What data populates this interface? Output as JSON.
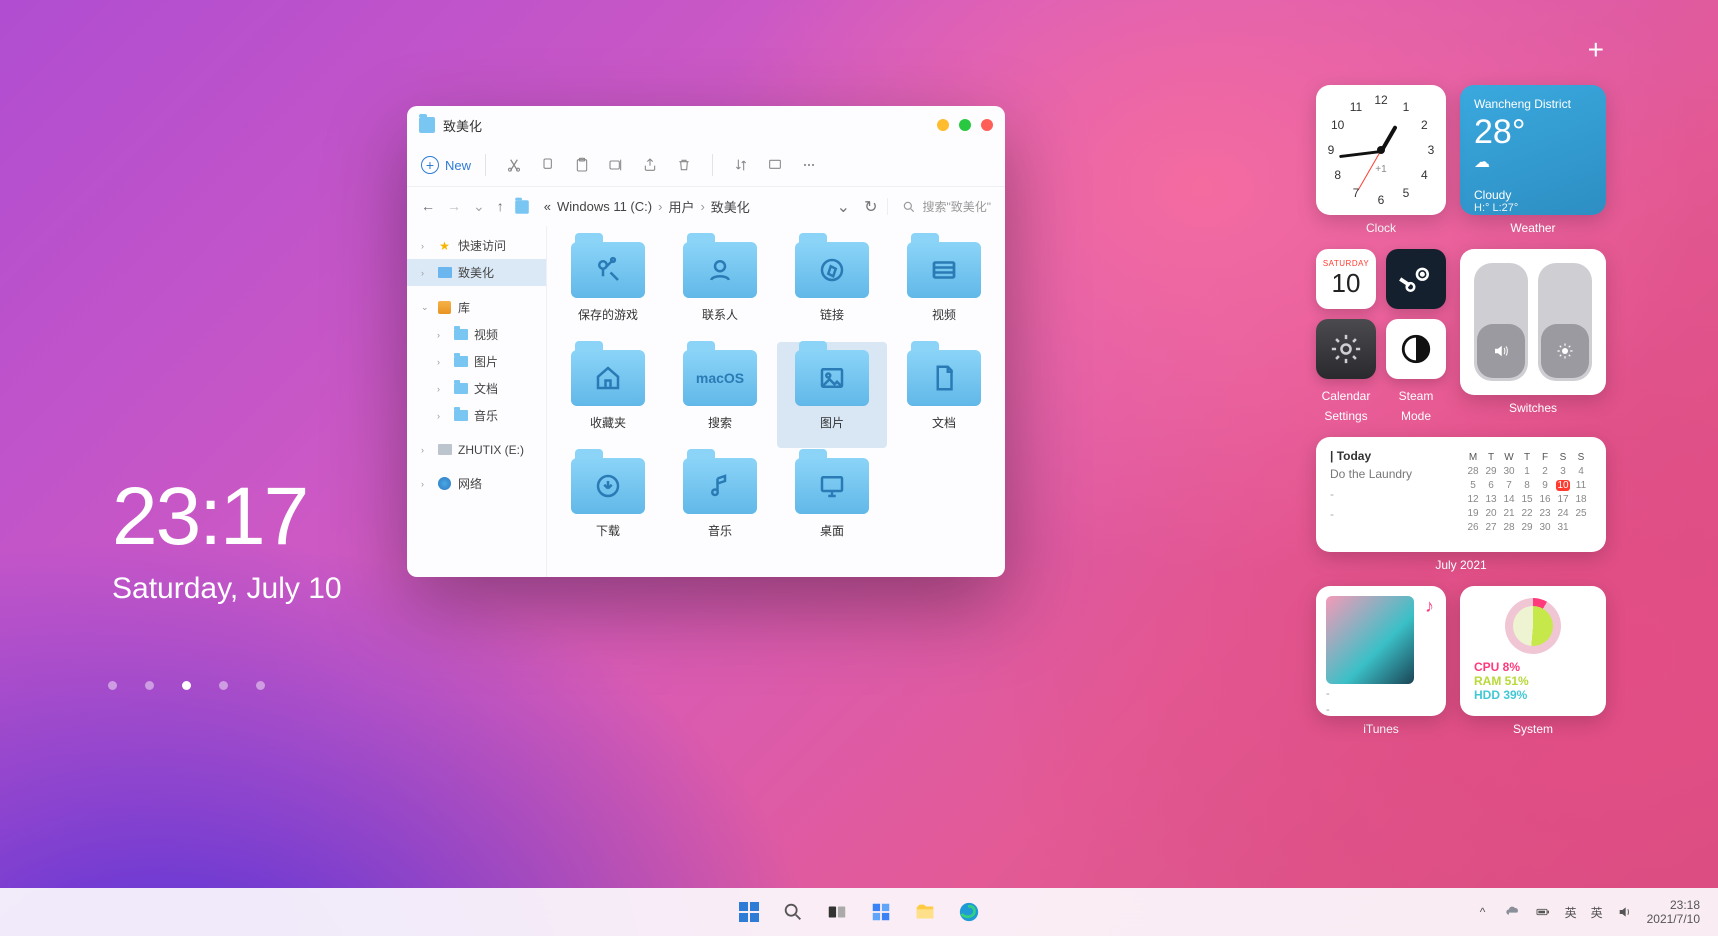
{
  "desktop": {
    "time": "23:17",
    "date": "Saturday, July 10"
  },
  "page_dots": {
    "count": 5,
    "active": 2
  },
  "plus_button": "+",
  "explorer": {
    "title": "致美化",
    "new_label": "New",
    "breadcrumb": {
      "drive_prefix": "«",
      "parts": [
        "Windows 11 (C:)",
        "用户",
        "致美化"
      ]
    },
    "search_placeholder": "搜索\"致美化\"",
    "sidebar": {
      "quick": "快速访问",
      "pinned": "致美化",
      "library": "库",
      "lib_items": [
        "视频",
        "图片",
        "文档",
        "音乐"
      ],
      "drive": "ZHUTIX (E:)",
      "network": "网络"
    },
    "folders": [
      {
        "label": "保存的游戏",
        "icon": "tools"
      },
      {
        "label": "联系人",
        "icon": "contact"
      },
      {
        "label": "链接",
        "icon": "compass"
      },
      {
        "label": "视频",
        "icon": "video"
      },
      {
        "label": "收藏夹",
        "icon": "home"
      },
      {
        "label": "搜索",
        "icon": "text",
        "text": "macOS"
      },
      {
        "label": "图片",
        "icon": "image",
        "selected": true
      },
      {
        "label": "文档",
        "icon": "doc"
      },
      {
        "label": "下载",
        "icon": "download"
      },
      {
        "label": "音乐",
        "icon": "music"
      },
      {
        "label": "桌面",
        "icon": "desktop"
      }
    ]
  },
  "widgets": {
    "clock": {
      "label": "Clock",
      "offset": "+1"
    },
    "weather": {
      "label": "Weather",
      "location": "Wancheng District",
      "temp": "28°",
      "condition": "Cloudy",
      "hilo": "H:° L:27°"
    },
    "calendar_small": {
      "label": "Calendar",
      "dow": "SATURDAY",
      "day": "10"
    },
    "steam": {
      "label": "Steam"
    },
    "settings": {
      "label": "Settings"
    },
    "mode": {
      "label": "Mode"
    },
    "switches": {
      "label": "Switches"
    },
    "agenda": {
      "label": "July 2021",
      "today": "| Today",
      "task": "Do the Laundry",
      "dow": [
        "M",
        "T",
        "W",
        "T",
        "F",
        "S",
        "S"
      ],
      "weeks": [
        [
          "28",
          "29",
          "30",
          "1",
          "2",
          "3",
          "4"
        ],
        [
          "5",
          "6",
          "7",
          "8",
          "9",
          "10",
          "11"
        ],
        [
          "12",
          "13",
          "14",
          "15",
          "16",
          "17",
          "18"
        ],
        [
          "19",
          "20",
          "21",
          "22",
          "23",
          "24",
          "25"
        ],
        [
          "26",
          "27",
          "28",
          "29",
          "30",
          "31",
          ""
        ]
      ],
      "today_cell": "10"
    },
    "itunes": {
      "label": "iTunes",
      "line1": "-",
      "line2": "-"
    },
    "system": {
      "label": "System",
      "cpu": "CPU 8%",
      "ram": "RAM 51%",
      "hdd": "HDD 39%"
    }
  },
  "taskbar": {
    "tray": {
      "ime1": "英",
      "ime2": "英",
      "time": "23:18",
      "date": "2021/7/10",
      "chevron": "^"
    }
  }
}
